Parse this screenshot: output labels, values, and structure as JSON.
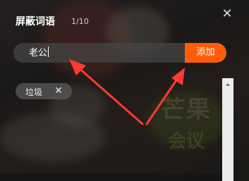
{
  "panel": {
    "title": "屏蔽词语",
    "counter": "1/10"
  },
  "input": {
    "value": "老公"
  },
  "add_button": {
    "label": "添加"
  },
  "tags": [
    {
      "label": "垃圾"
    }
  ],
  "background": {
    "watermark": "芒果",
    "watermark2": "会议"
  },
  "colors": {
    "accent": "#ff5c0a",
    "annotation_arrow": "#ff3b30"
  },
  "icons": {
    "close": "close-icon",
    "tag_remove": "close-icon",
    "scroll_up": "chevron-up-icon"
  }
}
